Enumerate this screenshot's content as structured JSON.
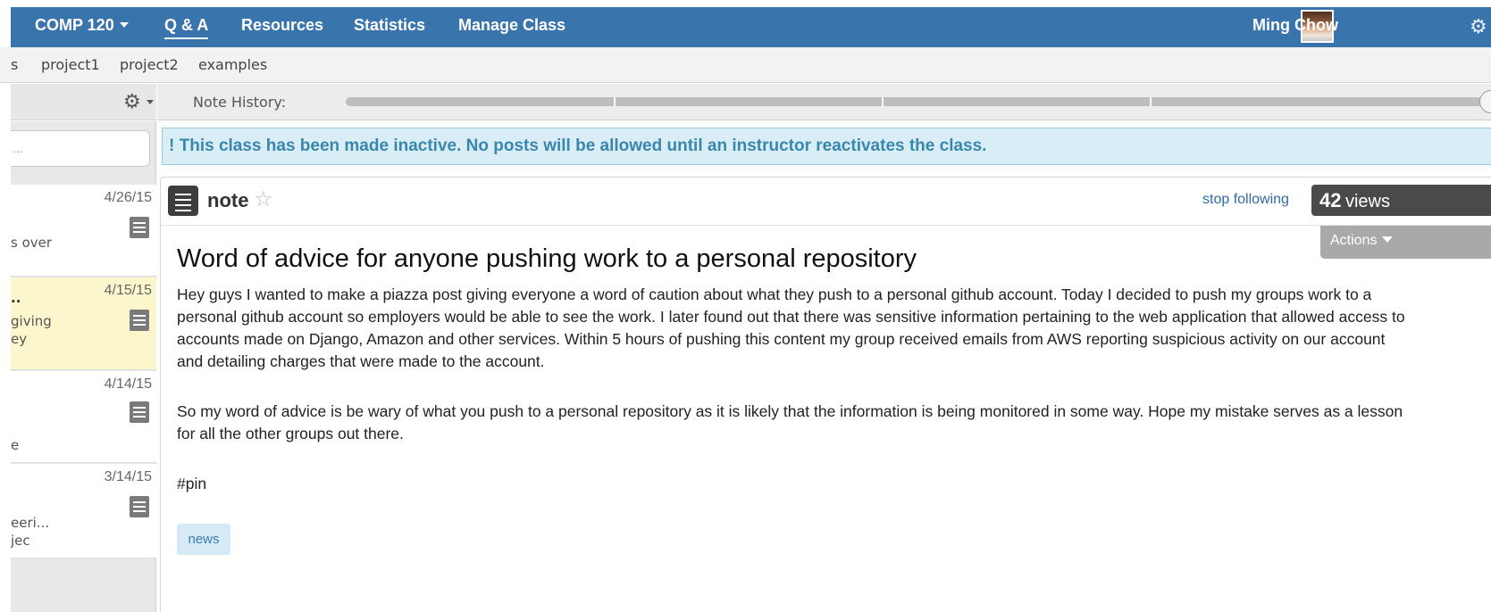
{
  "topnav": {
    "course": "COMP 120",
    "tabs": [
      "Q & A",
      "Resources",
      "Statistics",
      "Manage Class"
    ],
    "user": "Ming Chow",
    "brand_color": "#3a74ad"
  },
  "folders": [
    "s",
    "project1",
    "project2",
    "examples"
  ],
  "toolbar": {
    "history_label": "Note History:",
    "history_position": 1.0
  },
  "sidebar": {
    "search_text": "...",
    "items": [
      {
        "date": "4/26/15",
        "line1": "",
        "line2": "s over"
      },
      {
        "date": "4/15/15",
        "line1": "..",
        "line2": "giving",
        "line3": "ey"
      },
      {
        "date": "4/14/15",
        "line1": "",
        "line2": "e"
      },
      {
        "date": "3/14/15",
        "line1": "eeri...",
        "line2": "jec"
      }
    ]
  },
  "alert": "! This class has been made inactive. No posts will be allowed until an instructor reactivates the class.",
  "post": {
    "type": "note",
    "follow": "stop following",
    "views_count": "42",
    "views_label": "views",
    "actions": "Actions",
    "title": "Word of advice for anyone pushing work to a personal repository",
    "paragraphs": [
      "Hey guys I wanted to make a piazza post giving everyone a word of caution about what they push to a personal github account. Today I decided to push my groups work to a personal github account so employers would be able to see the work. I later found out that there was sensitive information pertaining to the web application that allowed access to accounts made on Django, Amazon and other services. Within 5 hours of pushing this content my group received emails from AWS reporting suspicious activity on our account and detailing charges that were made to the account.",
      "So my word of advice is be wary of what you push to a personal repository as it is likely that the information is being monitored in some way. Hope my mistake serves as a lesson for all the other groups out there.",
      "#pin"
    ],
    "tag": "news"
  }
}
